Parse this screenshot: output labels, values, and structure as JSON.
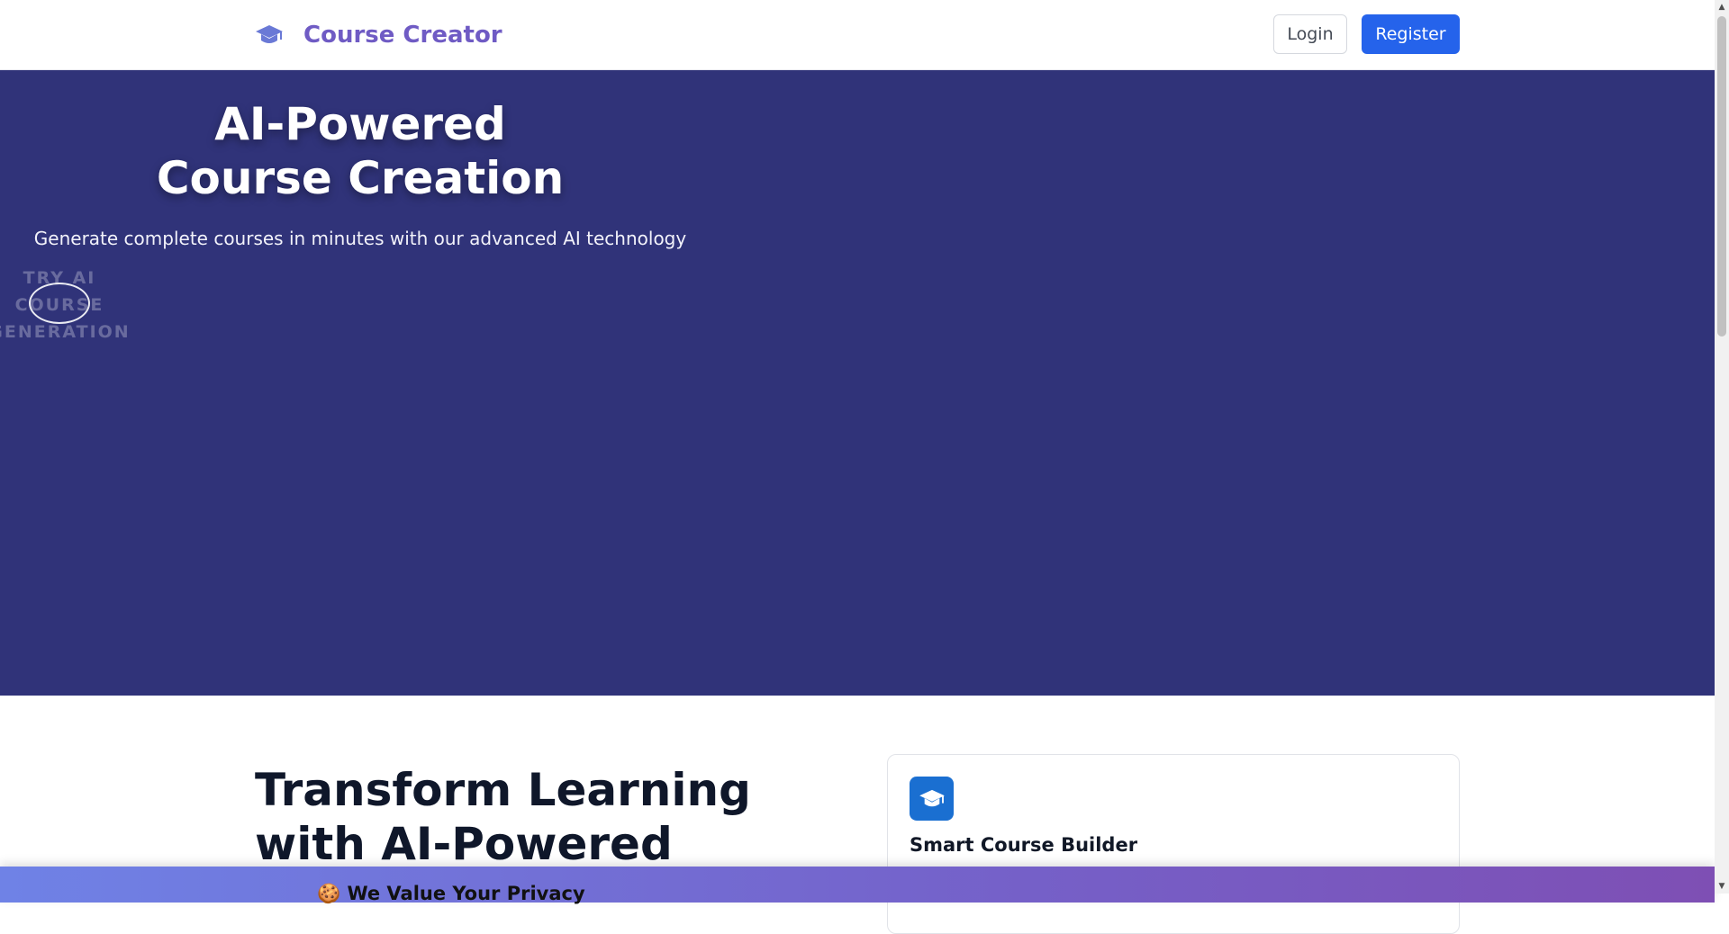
{
  "header": {
    "brand_icon": "graduation-cap-icon",
    "brand_name": "Course Creator",
    "login_label": "Login",
    "register_label": "Register"
  },
  "hero": {
    "title_line1": "AI-Powered",
    "title_line2": "Course Creation",
    "subtitle": "Generate complete courses in minutes with our advanced AI technology",
    "cta_line1": "TRY AI",
    "cta_line2": "COURSE",
    "cta_line3": "GENERATION",
    "background": "#303379"
  },
  "features": {
    "title_line1": "Transform Learning",
    "title_line2": "with AI-Powered",
    "card": {
      "icon": "graduation-cap-icon",
      "title": "Smart Course Builder"
    }
  },
  "cookie_banner": {
    "icon": "cookie-icon",
    "text": "🍪 We Value Your Privacy"
  },
  "colors": {
    "brand": "#6f5bc4",
    "primary": "#2563eb",
    "hero_bg": "#303379",
    "card_icon_bg": "#1a6fd1"
  }
}
